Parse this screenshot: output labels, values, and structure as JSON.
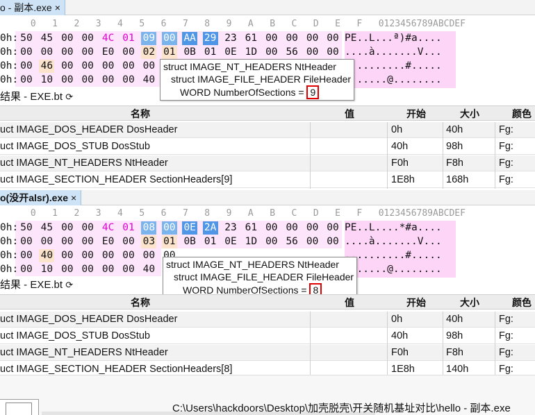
{
  "panel1": {
    "tab": {
      "label": "o - 副本.exe",
      "close": "×"
    },
    "col_header": " 0   1   2   3   4   5   6   7   8   9   A   B   C   D   E   F   0123456789ABCDEF",
    "rows": [
      {
        "addr": "0h:",
        "bytes": [
          "50",
          "45",
          "00",
          "00",
          "4C",
          "01",
          "09",
          "00",
          "AA",
          "29",
          "23",
          "61",
          "00",
          "00",
          "00",
          "00"
        ],
        "ascii": "PE..L...ª)#a...."
      },
      {
        "addr": "0h:",
        "bytes": [
          "00",
          "00",
          "00",
          "00",
          "E0",
          "00",
          "02",
          "01",
          "0B",
          "01",
          "0E",
          "1D",
          "00",
          "56",
          "00",
          "00"
        ],
        "ascii": "....à.......V..."
      },
      {
        "addr": "0h:",
        "bytes": [
          "00",
          "46",
          "00",
          "00",
          "00",
          "00",
          "00",
          "00",
          "",
          "",
          "",
          "",
          "",
          "",
          "",
          ""
        ],
        "ascii": "..........#....."
      },
      {
        "addr": "0h:",
        "bytes": [
          "00",
          "10",
          "00",
          "00",
          "00",
          "00",
          "40",
          "",
          "",
          "",
          "",
          "",
          "",
          "",
          "",
          ""
        ],
        "ascii": ".......@........"
      }
    ],
    "tooltip": {
      "line1": "struct IMAGE_NT_HEADERS NtHeader",
      "line2": "struct IMAGE_FILE_HEADER FileHeader",
      "line3": "WORD NumberOfSections = ",
      "value": "9"
    },
    "results_title": "结果 - EXE.bt ",
    "refresh_icon": "refresh-icon",
    "columns": {
      "name": "名称",
      "value": "值",
      "start": "开始",
      "size": "大小",
      "color": "颜色"
    },
    "table": [
      {
        "name": "uct IMAGE_DOS_HEADER DosHeader",
        "value": "",
        "start": "0h",
        "size": "40h",
        "color": "Fg:"
      },
      {
        "name": "uct IMAGE_DOS_STUB DosStub",
        "value": "",
        "start": "40h",
        "size": "98h",
        "color": "Fg:"
      },
      {
        "name": "uct IMAGE_NT_HEADERS NtHeader",
        "value": "",
        "start": "F0h",
        "size": "F8h",
        "color": "Fg:"
      },
      {
        "name": "uct IMAGE_SECTION_HEADER SectionHeaders[9]",
        "value": "",
        "start": "1E8h",
        "size": "168h",
        "color": "Fg:"
      }
    ]
  },
  "panel2": {
    "tab": {
      "label": "o(没开alsr).exe",
      "close": "×"
    },
    "col_header": " 0   1   2   3   4   5   6   7   8   9   A   B   C   D   E   F   0123456789ABCDEF",
    "rows": [
      {
        "addr": "0h:",
        "bytes": [
          "50",
          "45",
          "00",
          "00",
          "4C",
          "01",
          "08",
          "00",
          "0E",
          "2A",
          "23",
          "61",
          "00",
          "00",
          "00",
          "00"
        ],
        "ascii": "PE..L....*#a...."
      },
      {
        "addr": "0h:",
        "bytes": [
          "00",
          "00",
          "00",
          "00",
          "E0",
          "00",
          "03",
          "01",
          "0B",
          "01",
          "0E",
          "1D",
          "00",
          "56",
          "00",
          "00"
        ],
        "ascii": "....à.......V..."
      },
      {
        "addr": "0h:",
        "bytes": [
          "00",
          "40",
          "00",
          "00",
          "00",
          "00",
          "00",
          "00",
          "",
          "",
          "",
          "",
          "",
          "",
          "",
          ""
        ],
        "ascii": "..........#....."
      },
      {
        "addr": "0h:",
        "bytes": [
          "00",
          "10",
          "00",
          "00",
          "00",
          "00",
          "40",
          "",
          "",
          "",
          "",
          "",
          "",
          "",
          "",
          ""
        ],
        "ascii": ".......@........"
      }
    ],
    "tooltip": {
      "line1": "struct IMAGE_NT_HEADERS NtHeader",
      "line2": "struct IMAGE_FILE_HEADER FileHeader",
      "line3": "WORD NumberOfSections = ",
      "value": "8"
    },
    "results_title": "结果 - EXE.bt ",
    "refresh_icon": "refresh-icon",
    "columns": {
      "name": "名称",
      "value": "值",
      "start": "开始",
      "size": "大小",
      "color": "颜色"
    },
    "table": [
      {
        "name": "uct IMAGE_DOS_HEADER DosHeader",
        "value": "",
        "start": "0h",
        "size": "40h",
        "color": "Fg:"
      },
      {
        "name": "uct IMAGE_DOS_STUB DosStub",
        "value": "",
        "start": "40h",
        "size": "98h",
        "color": "Fg:"
      },
      {
        "name": "uct IMAGE_NT_HEADERS NtHeader",
        "value": "",
        "start": "F0h",
        "size": "F8h",
        "color": "Fg:"
      },
      {
        "name": "uct IMAGE_SECTION_HEADER SectionHeaders[8]",
        "value": "",
        "start": "1E8h",
        "size": "140h",
        "color": "Fg:"
      }
    ]
  },
  "footer": {
    "path": "C:\\Users\\hackdoors\\Desktop\\加壳脱壳\\开关随机基址对比\\hello - 副本.exe"
  },
  "colors": {
    "selection": "#79b4ec",
    "pink": "#fde6fb",
    "highlight_box": "#e00000",
    "tab": "#cfe3f7"
  }
}
